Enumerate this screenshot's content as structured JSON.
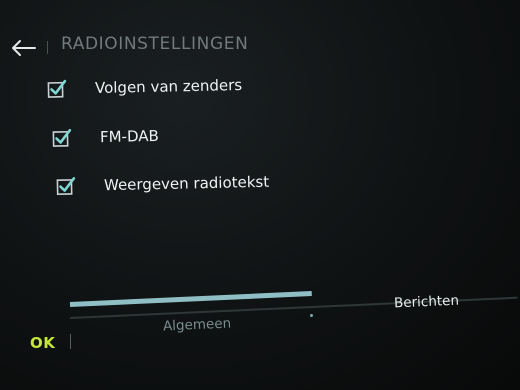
{
  "header": {
    "title": "RADIOINSTELLINGEN",
    "back_icon": "arrow-left-icon"
  },
  "options": [
    {
      "label": "Volgen van zenders",
      "checked": true
    },
    {
      "label": "FM-DAB",
      "checked": true
    },
    {
      "label": "Weergeven radiotekst",
      "checked": true
    }
  ],
  "tabs": [
    {
      "label": "Algemeen",
      "active": true
    },
    {
      "label": "Berichten",
      "active": false
    }
  ],
  "footer": {
    "ok_label": "OK"
  },
  "colors": {
    "accent": "#8fbfc4",
    "ok": "#c6e63c",
    "checkbox_check": "#7fd6d2"
  }
}
